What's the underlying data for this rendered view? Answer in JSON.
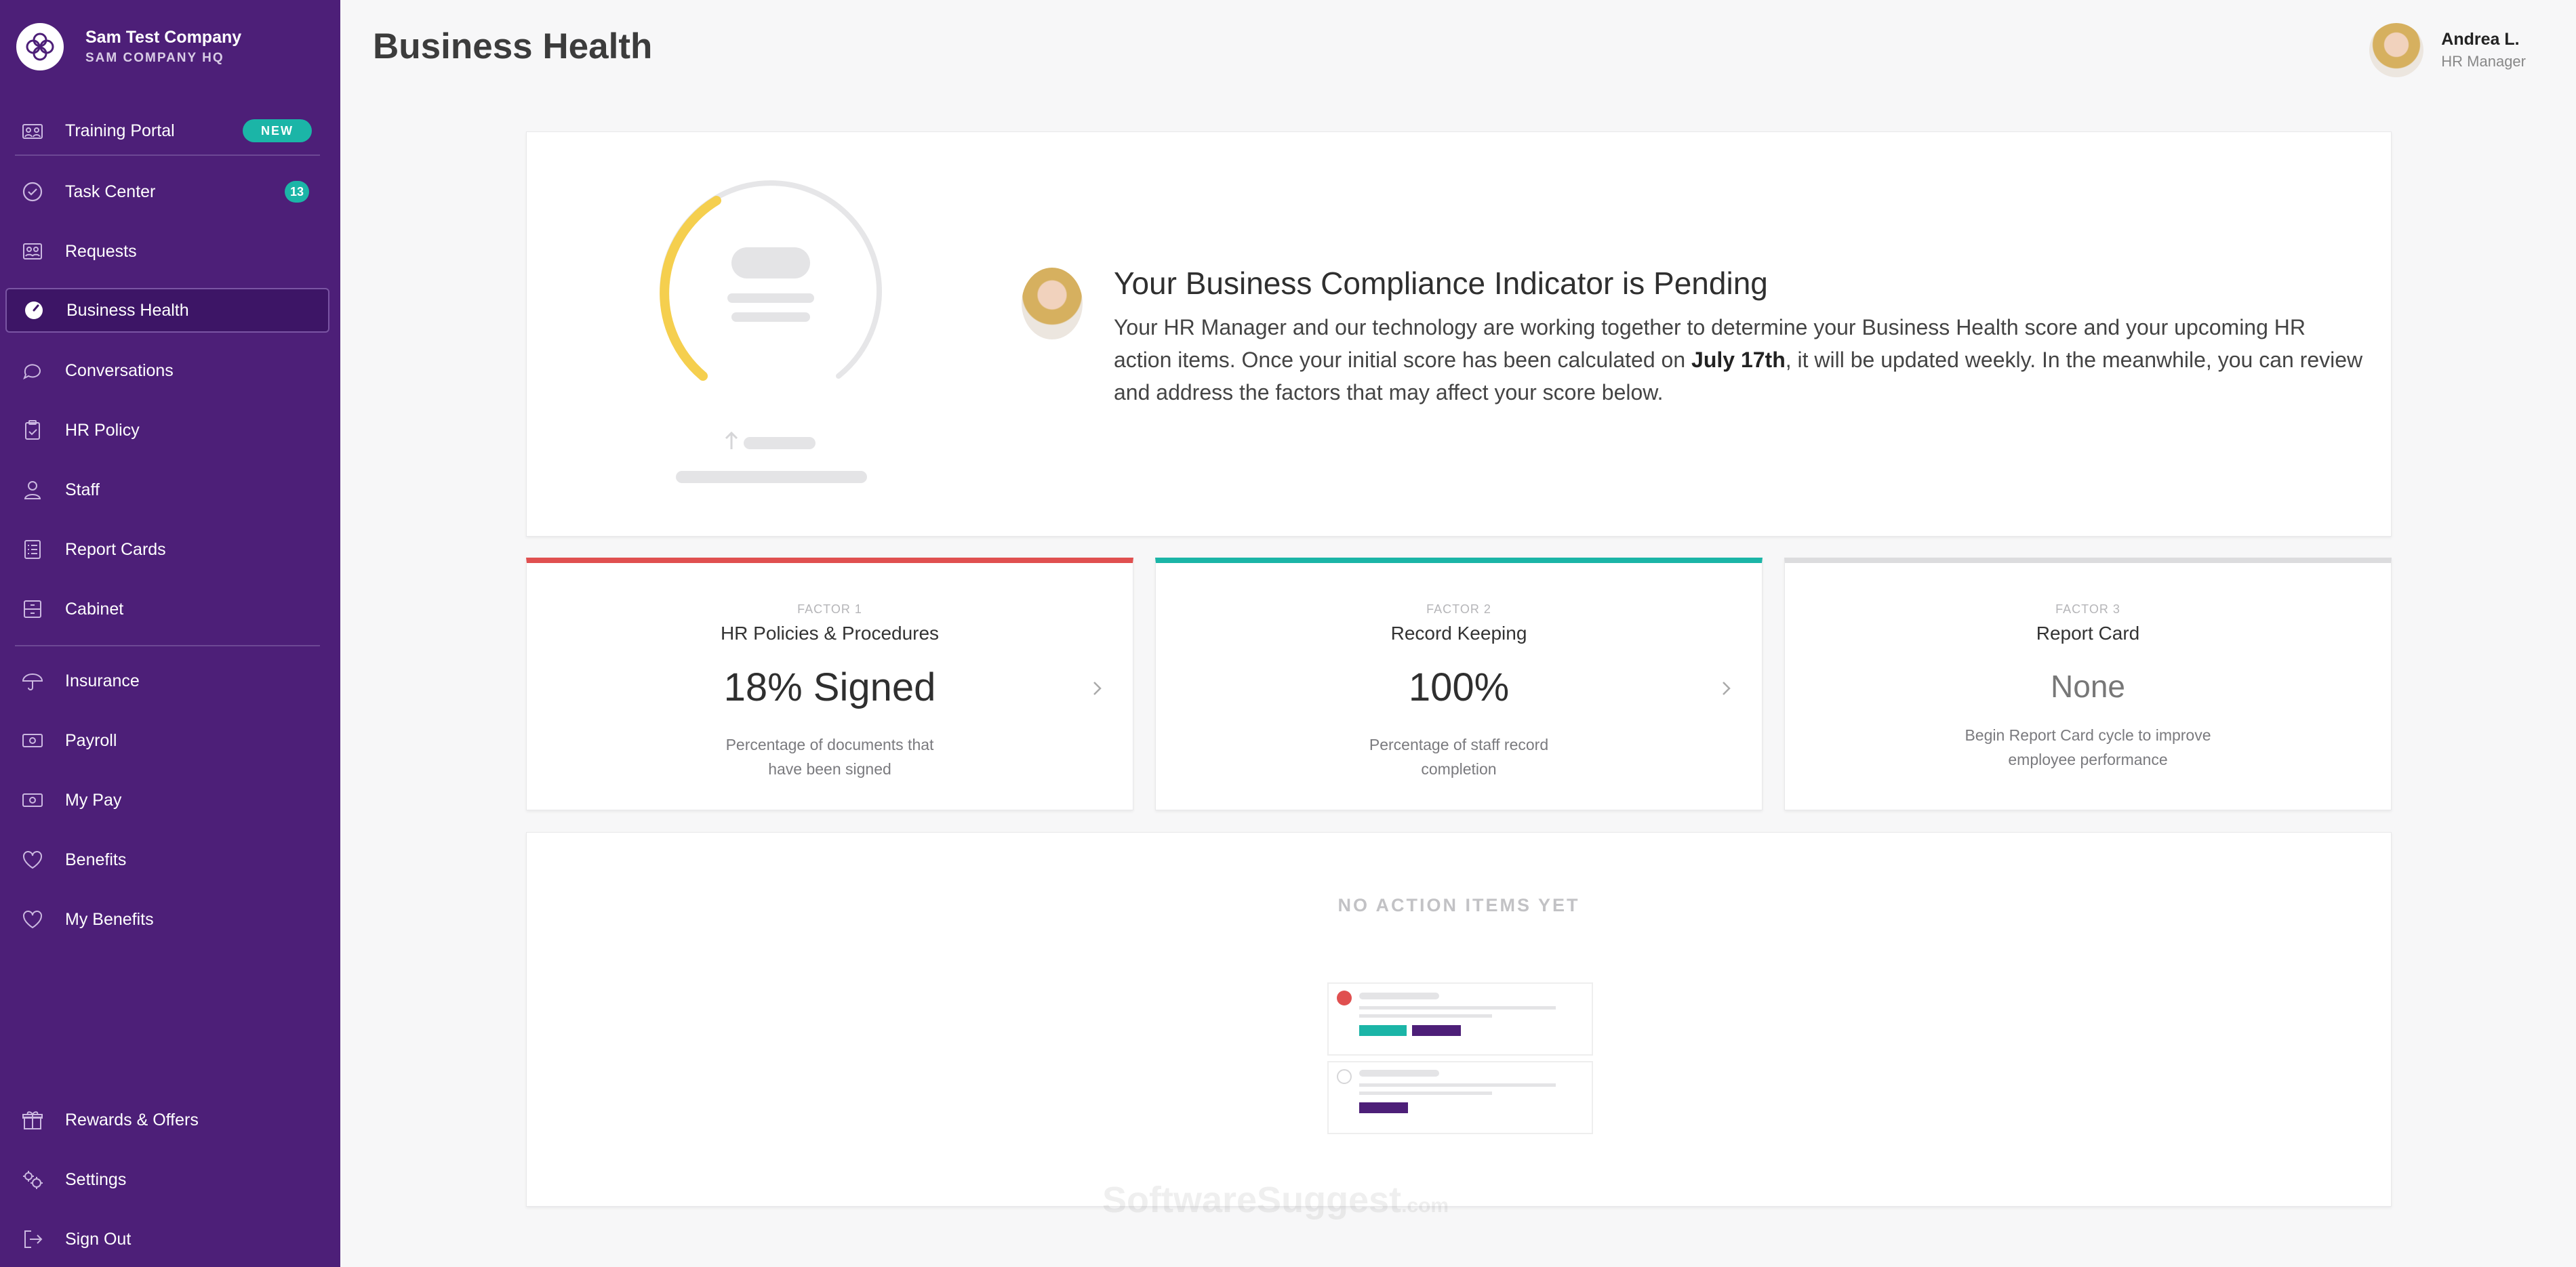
{
  "company": {
    "name": "Sam Test Company",
    "location": "SAM COMPANY HQ"
  },
  "nav": {
    "training": {
      "label": "Training Portal",
      "badge": "NEW"
    },
    "task_center": {
      "label": "Task Center",
      "badge": "13"
    },
    "requests": "Requests",
    "business_health": "Business Health",
    "conversations": "Conversations",
    "hr_policy": "HR Policy",
    "staff": "Staff",
    "report_cards": "Report Cards",
    "cabinet": "Cabinet",
    "insurance": "Insurance",
    "payroll": "Payroll",
    "my_pay": "My Pay",
    "benefits": "Benefits",
    "my_benefits": "My Benefits",
    "rewards": "Rewards & Offers",
    "settings": "Settings",
    "sign_out": "Sign Out"
  },
  "header": {
    "title": "Business Health"
  },
  "user": {
    "name": "Andrea L.",
    "role": "HR Manager"
  },
  "compliance": {
    "title": "Your Business Compliance Indicator is Pending",
    "body_pre": "Your HR Manager and our technology are working together to determine your Business Health score and your upcoming HR action items. Once your initial score has been calculated on ",
    "body_date": "July 17th",
    "body_post": ", it will be updated weekly. In the meanwhile, you can review and address the factors that may affect your score below."
  },
  "factors": [
    {
      "kicker": "FACTOR 1",
      "title": "HR Policies & Procedures",
      "value": "18% Signed",
      "desc": "Percentage of documents that have been signed",
      "color": "#e05050"
    },
    {
      "kicker": "FACTOR 2",
      "title": "Record Keeping",
      "value": "100%",
      "desc": "Percentage of staff record completion",
      "color": "#1bb5a7"
    },
    {
      "kicker": "FACTOR 3",
      "title": "Report Card",
      "value": "None",
      "desc": "Begin Report Card cycle to improve employee performance",
      "color": "#dcdcde"
    }
  ],
  "actions": {
    "title": "NO ACTION ITEMS YET"
  },
  "watermark": {
    "main": "SoftwareSuggest",
    "suffix": ".com"
  },
  "colors": {
    "sidebar": "#4d1f78",
    "accent": "#1bb5a7",
    "gauge": "#f5cf4e"
  }
}
